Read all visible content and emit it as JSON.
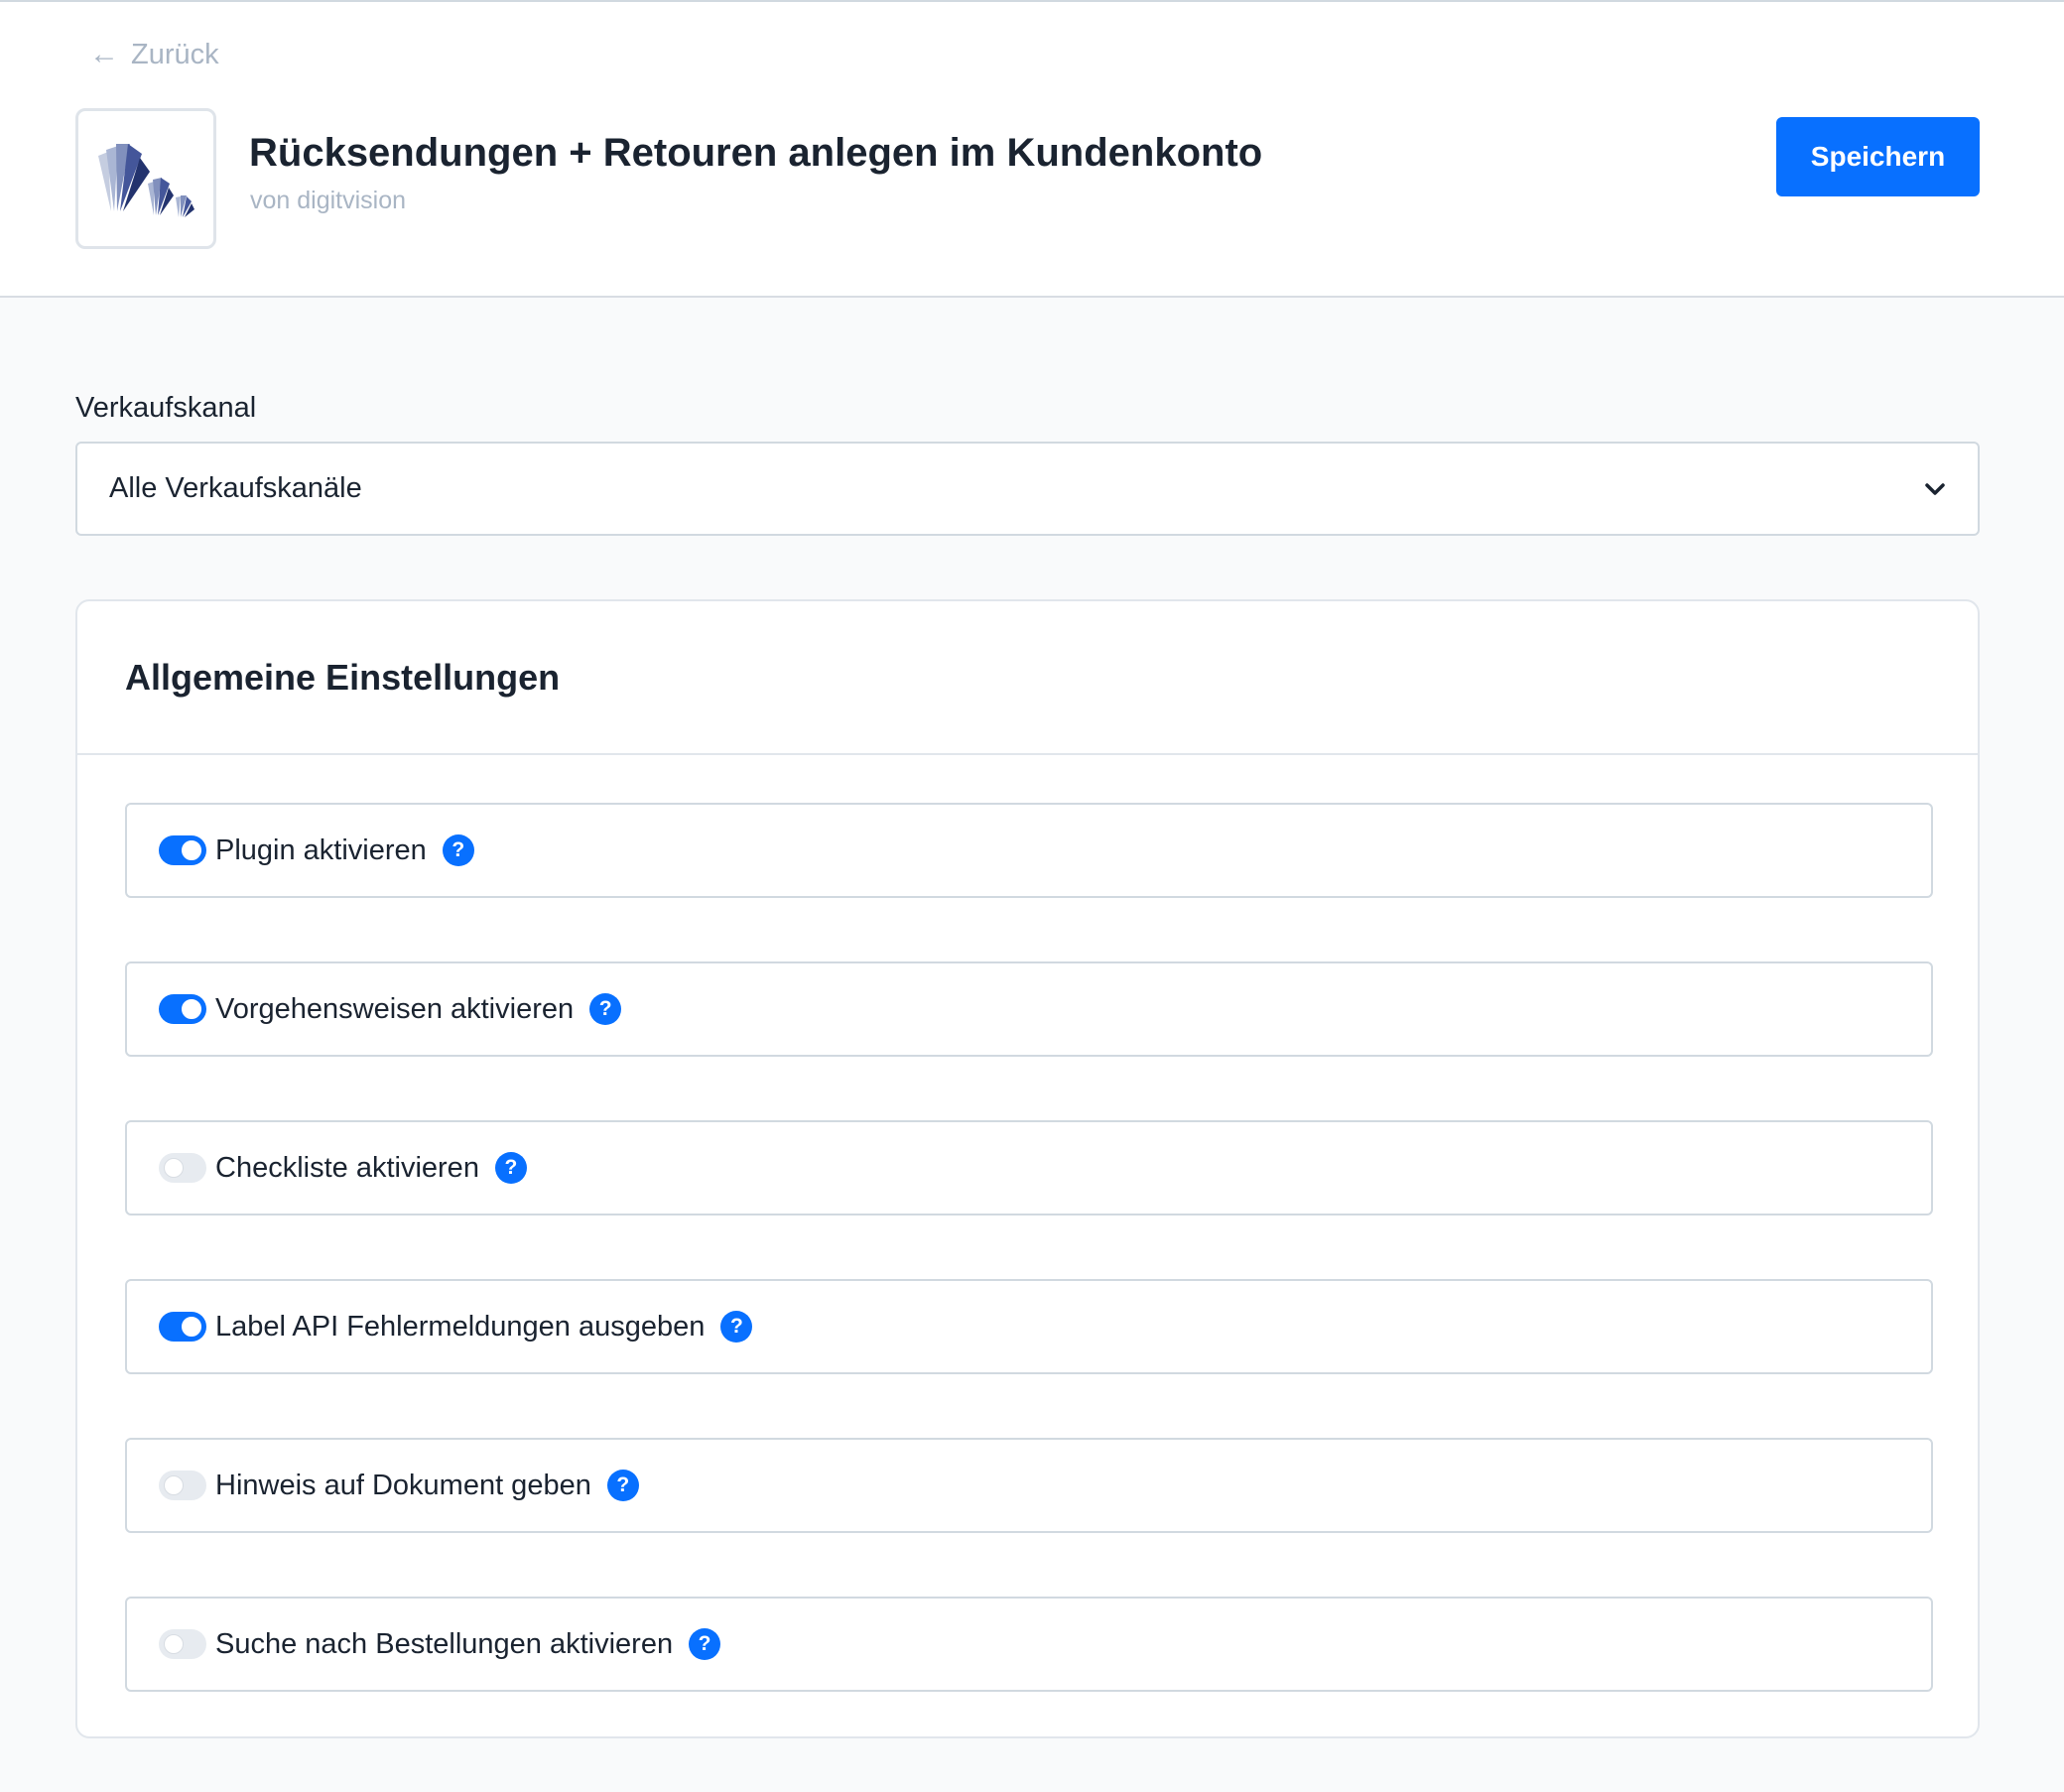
{
  "header": {
    "back_label": "Zurück",
    "title": "Rücksendungen + Retouren anlegen im Kundenkonto",
    "vendor": "von digitvision",
    "save_label": "Speichern"
  },
  "channel": {
    "label": "Verkaufskanal",
    "selected": "Alle Verkaufskanäle"
  },
  "general": {
    "title": "Allgemeine Einstellungen",
    "settings": [
      {
        "label": "Plugin aktivieren",
        "enabled": true
      },
      {
        "label": "Vorgehensweisen aktivieren",
        "enabled": true
      },
      {
        "label": "Checkliste aktivieren",
        "enabled": false
      },
      {
        "label": "Label API Fehlermeldungen ausgeben",
        "enabled": true
      },
      {
        "label": "Hinweis auf Dokument geben",
        "enabled": false
      },
      {
        "label": "Suche nach Bestellungen aktivieren",
        "enabled": false
      }
    ],
    "help_glyph": "?"
  },
  "colors": {
    "accent": "#0870ff",
    "muted_text": "#a9b5c4",
    "text": "#1a2330",
    "border": "#d1d9e0"
  },
  "icons": {
    "back": "arrow-left-icon",
    "select": "chevron-down-icon",
    "help": "help-icon",
    "logo": "digitvision-logo"
  }
}
